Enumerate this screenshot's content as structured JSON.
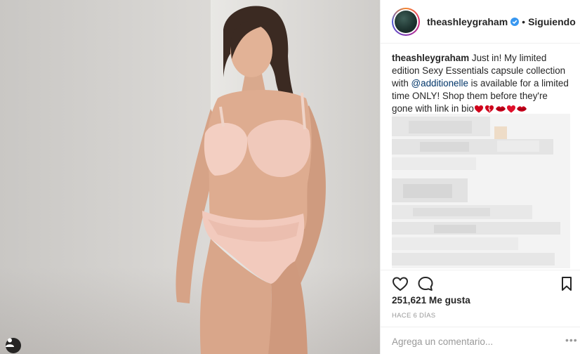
{
  "post": {
    "username": "theashleygraham",
    "follow_status": "Siguiendo",
    "separator": "•",
    "caption": {
      "username": "theashleygraham",
      "text_before": " Just in! My limited edition Sexy Essentials capsule collection with ",
      "mention": "@additionelle",
      "text_after": " is available for a limited time ONLY! Shop them before they're gone with link in bio"
    },
    "likes": "251,621 Me gusta",
    "timestamp": "HACE 6 DÍAS",
    "comment_placeholder": "Agrega un comentario...",
    "more_label": "•••"
  },
  "icons": {
    "verified": "verified-badge-icon",
    "like": "heart-icon",
    "comment": "speech-bubble-icon",
    "save": "bookmark-icon",
    "tag": "user-tag-icon",
    "emojis": [
      "red-heart-icon",
      "heart-broken-icon",
      "lips-icon",
      "heart-icon",
      "lips-icon"
    ]
  },
  "colors": {
    "verified_blue": "#3897f0",
    "mention": "#003569",
    "text": "#262626",
    "muted": "#999999",
    "emoji_red": "#d0021b"
  }
}
